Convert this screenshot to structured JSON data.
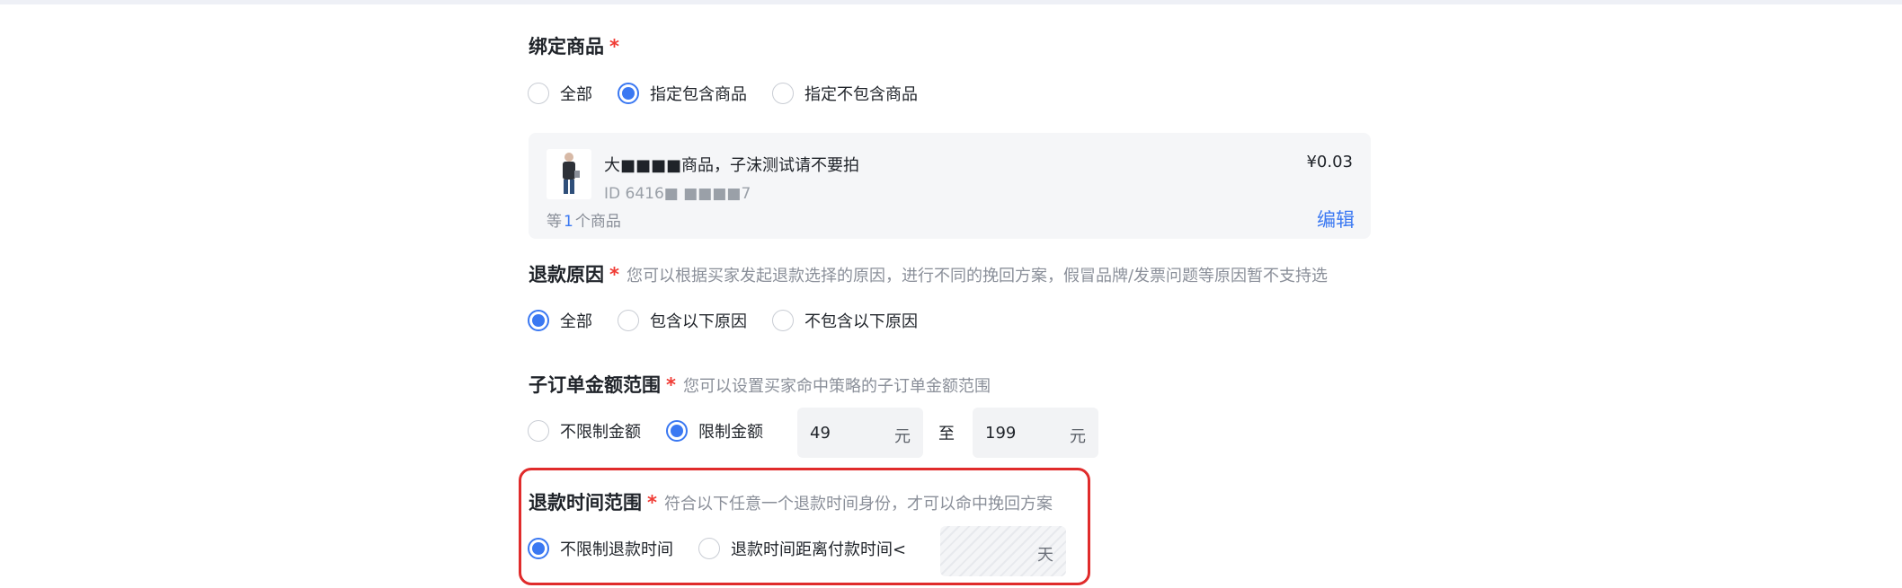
{
  "bind_goods": {
    "title": "绑定商品",
    "required_mark": "*",
    "options": [
      {
        "label": "全部",
        "checked": false
      },
      {
        "label": "指定包含商品",
        "checked": true
      },
      {
        "label": "指定不包含商品",
        "checked": false
      }
    ],
    "product": {
      "name": "大■■■■商品，子沫测试请不要拍",
      "id_text": "ID 6416■ ■■■■7",
      "price": "¥0.03",
      "count_prefix": "等",
      "count": "1",
      "count_suffix": "个商品",
      "edit_label": "编辑"
    }
  },
  "refund_reason": {
    "title": "退款原因",
    "required_mark": "*",
    "hint": "您可以根据买家发起退款选择的原因，进行不同的挽回方案，假冒品牌/发票问题等原因暂不支持选",
    "options": [
      {
        "label": "全部",
        "checked": true
      },
      {
        "label": "包含以下原因",
        "checked": false
      },
      {
        "label": "不包含以下原因",
        "checked": false
      }
    ]
  },
  "amount_range": {
    "title": "子订单金额范围",
    "required_mark": "*",
    "hint": "您可以设置买家命中策略的子订单金额范围",
    "options": [
      {
        "label": "不限制金额",
        "checked": false
      },
      {
        "label": "限制金额",
        "checked": true
      }
    ],
    "min_value": "49",
    "max_value": "199",
    "unit": "元",
    "to_label": "至"
  },
  "refund_time": {
    "title": "退款时间范围",
    "required_mark": "*",
    "hint": "符合以下任意一个退款时间身份，才可以命中挽回方案",
    "options": [
      {
        "label": "不限制退款时间",
        "checked": true
      },
      {
        "label": "退款时间距离付款时间<",
        "checked": false
      }
    ],
    "unit": "天"
  },
  "colors": {
    "primary": "#3a78f2",
    "required": "#f03b34",
    "highlight": "#e02b2b"
  }
}
